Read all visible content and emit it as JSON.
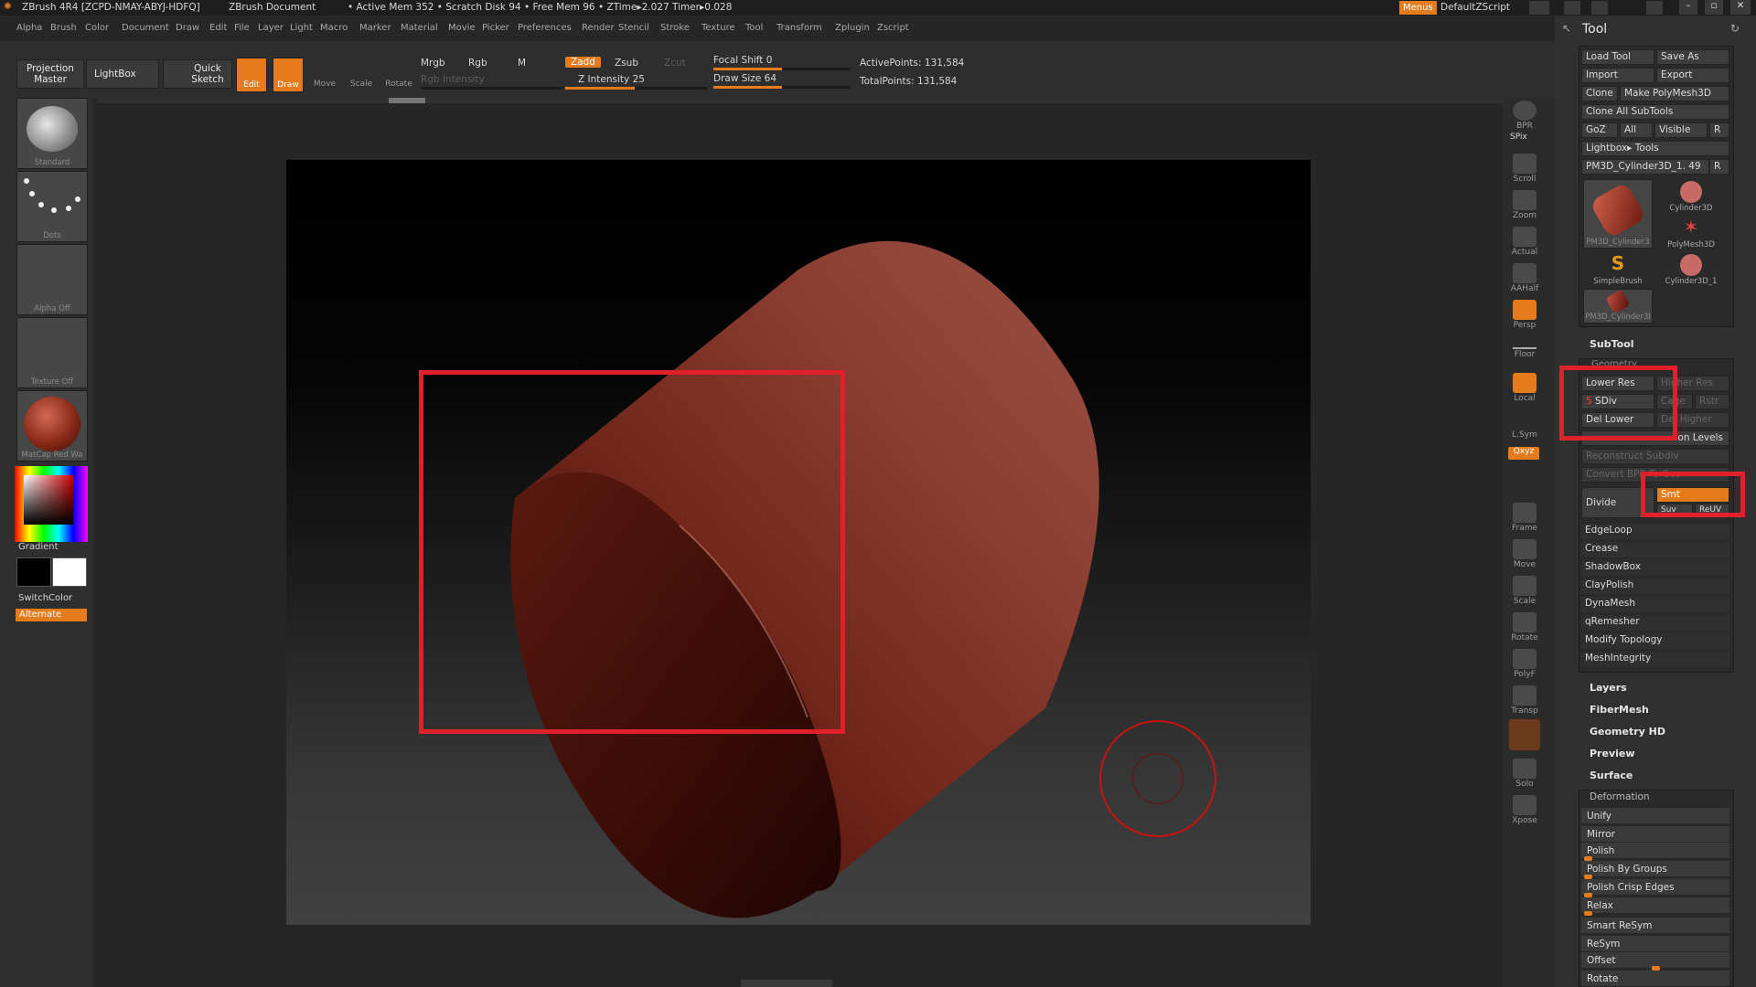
{
  "title": {
    "app": "ZBrush 4R4 [ZCPD-NMAY-ABYJ-HDFQ]",
    "doc": "ZBrush Document",
    "stats": "• Active Mem 352 • Scratch Disk 94 • Free Mem 96 • ZTime▸2.027 Timer▸0.028",
    "menus": "Menus",
    "script": "DefaultZScript"
  },
  "menubar": [
    "Alpha",
    "Brush",
    "Color",
    "Document",
    "Draw",
    "Edit",
    "File",
    "Layer",
    "Light",
    "Macro",
    "Marker",
    "Material",
    "Movie",
    "Picker",
    "Preferences",
    "Render",
    "Stencil",
    "Stroke",
    "Texture",
    "Tool",
    "Transform",
    "Zplugin",
    "Zscript"
  ],
  "toolbar": {
    "projection_master": "Projection Master",
    "lightbox": "LightBox",
    "quick_sketch": "Quick Sketch",
    "edit": "Edit",
    "draw": "Draw",
    "move": "Move",
    "scale": "Scale",
    "rotate": "Rotate",
    "mrgb": "Mrgb",
    "rgb": "Rgb",
    "m": "M",
    "rgb_intensity": "Rgb Intensity",
    "zadd": "Zadd",
    "zsub": "Zsub",
    "zcut": "Zcut",
    "z_intensity": "Z Intensity 25",
    "focal_shift": "Focal Shift 0",
    "draw_size": "Draw Size 64",
    "active_points": "ActivePoints: 131,584",
    "total_points": "TotalPoints: 131,584"
  },
  "left": {
    "brush": "Standard",
    "stroke": "Dots",
    "alpha": "Alpha Off",
    "texture": "Texture Off",
    "material": "MatCap Red Wa",
    "gradient": "Gradient",
    "switch_color": "SwitchColor",
    "alternate": "Alternate"
  },
  "rightbar": [
    "BPR",
    "Scroll",
    "Zoom",
    "Actual",
    "AAHalf",
    "Persp",
    "Floor",
    "Local",
    "L.Sym",
    "Frame",
    "Move",
    "Scale",
    "Rotate",
    "PolyF",
    "Transp",
    "Solo",
    "Xpose"
  ],
  "rightbar_extra": {
    "spix": "SPix",
    "xyz": "Qxyz"
  },
  "tool": {
    "header": "Tool",
    "load_tool": "Load Tool",
    "save_as": "Save As",
    "import": "Import",
    "export": "Export",
    "clone": "Clone",
    "make_polymesh": "Make PolyMesh3D",
    "clone_all": "Clone All SubTools",
    "goz": "GoZ",
    "all": "All",
    "visible": "Visible",
    "r": "R",
    "lightbox_tools": "Lightbox▸ Tools",
    "current_tool": "PM3D_Cylinder3D_1. 49",
    "r2": "R",
    "thumbs": [
      "PM3D_Cylinder3",
      "Cylinder3D",
      "PolyMesh3D",
      "SimpleBrush",
      "Cylinder3D_1",
      "PM3D_Cylinder3I"
    ],
    "subtool": "SubTool",
    "geometry": "Geometry",
    "lower_res": "Lower Res",
    "higher_res": "Higher Res",
    "sdiv_num": "5",
    "sdiv": "SDiv",
    "cage": "Cage",
    "rstr": "Rstr",
    "del_lower": "Del Lower",
    "del_higher": "Del Higher",
    "freeze_levels": "on Levels",
    "reconstruct": "Reconstruct Subdiv",
    "convert": "Convert BPR To Geo",
    "divide": "Divide",
    "smt": "Smt",
    "suv": "Suv",
    "reuv": "ReUV",
    "geo_items": [
      "EdgeLoop",
      "Crease",
      "ShadowBox",
      "ClayPolish",
      "DynaMesh",
      "qRemesher",
      "Modify Topology",
      "MeshIntegrity"
    ],
    "sections": [
      "Layers",
      "FiberMesh",
      "Geometry HD",
      "Preview",
      "Surface"
    ],
    "deformation": "Deformation",
    "deform_items": [
      "Unify",
      "Mirror",
      "Polish",
      "Polish By Groups",
      "Polish Crisp Edges",
      "Relax",
      "Smart ReSym",
      "ReSym",
      "Offset",
      "Rotate"
    ]
  }
}
